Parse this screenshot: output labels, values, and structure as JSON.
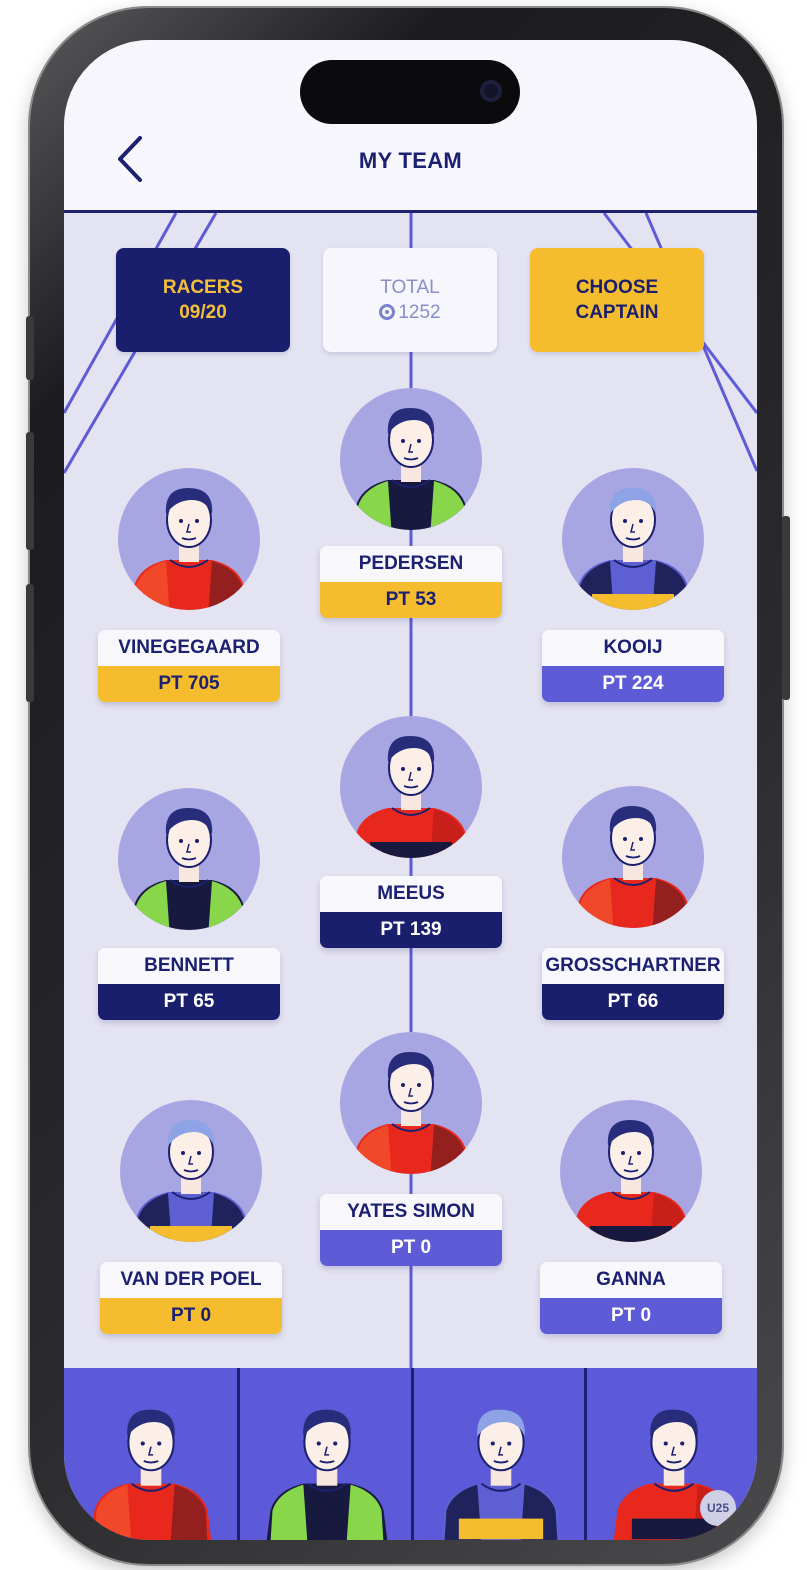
{
  "header": {
    "title": "MY TEAM"
  },
  "stats": {
    "racers_label": "RACERS",
    "racers_value": "09/20",
    "total_label": "TOTAL",
    "total_value": "1252",
    "captain_label_line1": "CHOOSE",
    "captain_label_line2": "CAPTAIN"
  },
  "riders": [
    {
      "name": "PEDERSEN",
      "points": "PT 53",
      "tag": "yellow",
      "jersey": "green-black"
    },
    {
      "name": "VINEGEGAARD",
      "points": "PT 705",
      "tag": "yellow",
      "jersey": "red"
    },
    {
      "name": "KOOIJ",
      "points": "PT 224",
      "tag": "violet",
      "jersey": "blue-yellow"
    },
    {
      "name": "MEEUS",
      "points": "PT 139",
      "tag": "navy",
      "jersey": "red-navy"
    },
    {
      "name": "BENNETT",
      "points": "PT 65",
      "tag": "navy",
      "jersey": "green-black"
    },
    {
      "name": "GROSSCHARTNER",
      "points": "PT 66",
      "tag": "navy",
      "jersey": "red"
    },
    {
      "name": "YATES SIMON",
      "points": "PT 0",
      "tag": "violet",
      "jersey": "red"
    },
    {
      "name": "VAN DER POEL",
      "points": "PT 0",
      "tag": "yellow",
      "jersey": "blue-yellow"
    },
    {
      "name": "GANNA",
      "points": "PT 0",
      "tag": "violet",
      "jersey": "red-navy"
    }
  ],
  "bench": [
    {
      "jersey": "red"
    },
    {
      "jersey": "green-black"
    },
    {
      "jersey": "blue-yellow"
    },
    {
      "jersey": "red-navy"
    }
  ],
  "bench_badge": "U25",
  "colors": {
    "navy": "#1a1f6d",
    "yellow": "#f5bd2e",
    "violet": "#5e5bd6",
    "field": "#e4e3f1"
  }
}
